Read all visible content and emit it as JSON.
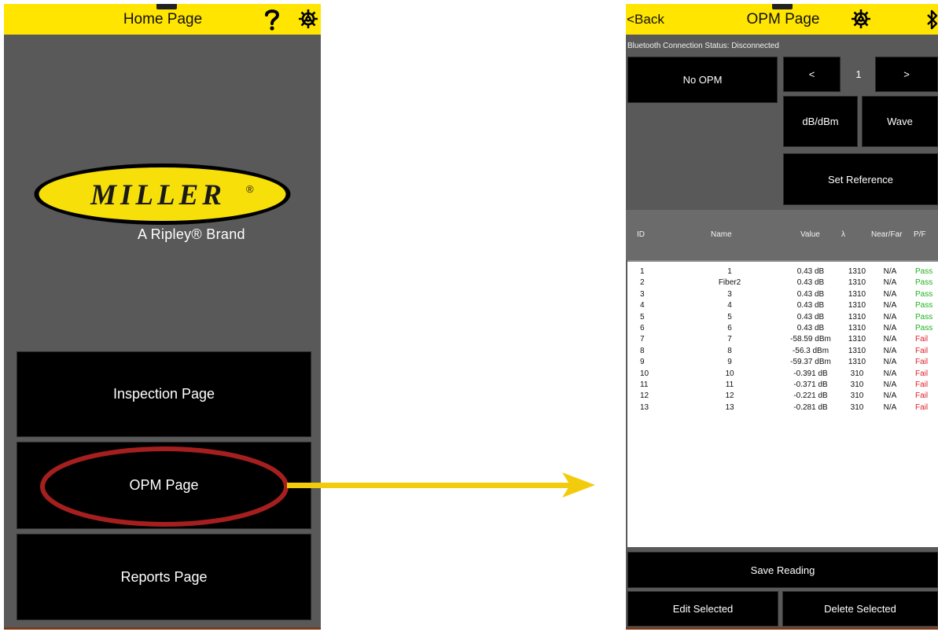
{
  "home": {
    "title": "Home Page",
    "help_icon": "question-icon",
    "settings_icon": "gear-icon",
    "logo": {
      "text": "MILLER",
      "registered": "®"
    },
    "brand_line": "A Ripley® Brand",
    "buttons": [
      "Inspection Page",
      "OPM Page",
      "Reports Page"
    ]
  },
  "opm": {
    "back_label": "<Back",
    "title": "OPM Page",
    "settings_icon": "gear-icon",
    "bluetooth_icon": "bluetooth-icon",
    "status": "Bluetooth Connection Status: Disconnected",
    "device_label": "No OPM",
    "prev_label": "<",
    "page_number": "1",
    "next_label": ">",
    "unit_label": "dB/dBm",
    "wave_label": "Wave",
    "set_reference_label": "Set Reference",
    "table": {
      "headers": [
        "ID",
        "Name",
        "Value",
        "λ",
        "Near/Far",
        "P/F"
      ],
      "rows": [
        {
          "id": "1",
          "name": "1",
          "value": "0.43 dB",
          "lambda": "1310",
          "nf": "N/A",
          "pf": "Pass"
        },
        {
          "id": "2",
          "name": "Fiber2",
          "value": "0.43 dB",
          "lambda": "1310",
          "nf": "N/A",
          "pf": "Pass"
        },
        {
          "id": "3",
          "name": "3",
          "value": "0.43 dB",
          "lambda": "1310",
          "nf": "N/A",
          "pf": "Pass"
        },
        {
          "id": "4",
          "name": "4",
          "value": "0.43 dB",
          "lambda": "1310",
          "nf": "N/A",
          "pf": "Pass"
        },
        {
          "id": "5",
          "name": "5",
          "value": "0.43 dB",
          "lambda": "1310",
          "nf": "N/A",
          "pf": "Pass"
        },
        {
          "id": "6",
          "name": "6",
          "value": "0.43 dB",
          "lambda": "1310",
          "nf": "N/A",
          "pf": "Pass"
        },
        {
          "id": "7",
          "name": "7",
          "value": "-58.59 dBm",
          "lambda": "1310",
          "nf": "N/A",
          "pf": "Fail"
        },
        {
          "id": "8",
          "name": "8",
          "value": "-56.3 dBm",
          "lambda": "1310",
          "nf": "N/A",
          "pf": "Fail"
        },
        {
          "id": "9",
          "name": "9",
          "value": "-59.37 dBm",
          "lambda": "1310",
          "nf": "N/A",
          "pf": "Fail"
        },
        {
          "id": "10",
          "name": "10",
          "value": "-0.391 dB",
          "lambda": "310",
          "nf": "N/A",
          "pf": "Fail"
        },
        {
          "id": "11",
          "name": "11",
          "value": "-0.371 dB",
          "lambda": "310",
          "nf": "N/A",
          "pf": "Fail"
        },
        {
          "id": "12",
          "name": "12",
          "value": "-0.221 dB",
          "lambda": "310",
          "nf": "N/A",
          "pf": "Fail"
        },
        {
          "id": "13",
          "name": "13",
          "value": "-0.281 dB",
          "lambda": "310",
          "nf": "N/A",
          "pf": "Fail"
        }
      ]
    },
    "save_label": "Save Reading",
    "edit_label": "Edit Selected",
    "delete_label": "Delete Selected"
  },
  "colors": {
    "topbar": "#ffe500",
    "panel": "#595959",
    "pass": "#1db31d",
    "fail": "#e0202a",
    "highlight": "#a61f1f",
    "arrow": "#f2cc0c"
  }
}
